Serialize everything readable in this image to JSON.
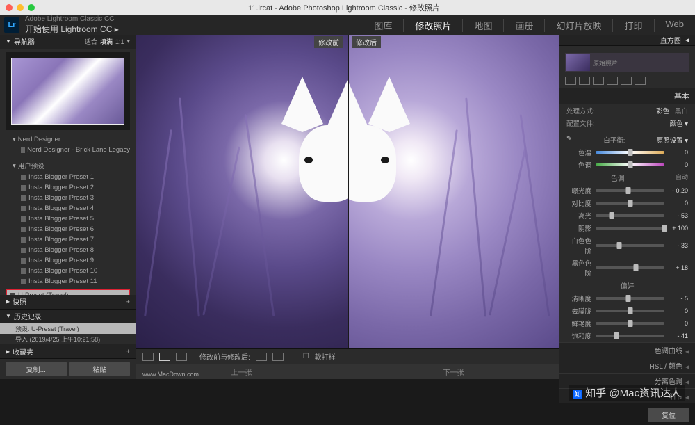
{
  "titlebar": {
    "text": "11.lrcat - Adobe Photoshop Lightroom Classic - 修改照片"
  },
  "traffic": {
    "close": "#ff5f56",
    "min": "#ffbd2e",
    "max": "#27c93f"
  },
  "header": {
    "app_line1": "Adobe Lightroom Classic CC",
    "app_line2": "开始使用 Lightroom CC ▸"
  },
  "modules": [
    {
      "label": "图库",
      "active": false
    },
    {
      "label": "修改照片",
      "active": true
    },
    {
      "label": "地图",
      "active": false
    },
    {
      "label": "画册",
      "active": false
    },
    {
      "label": "幻灯片放映",
      "active": false
    },
    {
      "label": "打印",
      "active": false
    },
    {
      "label": "Web",
      "active": false
    }
  ],
  "left": {
    "navigator": {
      "title": "导航器",
      "fit": "适合",
      "fill": "填满",
      "ratio": "1:1"
    },
    "nerd_header": "Nerd Designer",
    "nerd_item": "Nerd Designer - Brick Lane Legacy",
    "user_presets_header": "用户预设",
    "presets": [
      "Insta Blogger Preset 1",
      "Insta Blogger Preset 2",
      "Insta Blogger Preset 3",
      "Insta Blogger Preset 4",
      "Insta Blogger Preset 5",
      "Insta Blogger Preset 6",
      "Insta Blogger Preset 7",
      "Insta Blogger Preset 8",
      "Insta Blogger Preset 9",
      "Insta Blogger Preset 10",
      "Insta Blogger Preset 11"
    ],
    "selected_preset": "U-Preset (Travel)",
    "snapshot": "快照",
    "history": "历史记录",
    "history_items": [
      "预设: U-Preset (Travel)",
      "导入 (2019/4/25 上午10:21:58)"
    ],
    "collections": "收藏夹",
    "copy_btn": "复制...",
    "paste_btn": "粘贴"
  },
  "center": {
    "before": "修改前",
    "after": "修改后",
    "compare_label": "修改前与修改后:",
    "soft_proof": "软打样",
    "prev": "上一张",
    "next": "下一张"
  },
  "right": {
    "histogram": "直方图",
    "original_photo": "原始照片",
    "basic": "基本",
    "treatment": "处理方式:",
    "color": "彩色",
    "bw": "黑白",
    "profile_lbl": "配置文件:",
    "profile_val": "颜色 ▾",
    "wb_lbl": "白平衡:",
    "wb_val": "原照设置 ▾",
    "temp_lbl": "色温",
    "temp_val": "0",
    "tint_lbl": "色调",
    "tint_val": "0",
    "tone_hdr": "色调",
    "auto": "自动",
    "exposure_lbl": "曝光度",
    "exposure_val": "- 0.20",
    "contrast_lbl": "对比度",
    "contrast_val": "0",
    "highlights_lbl": "高光",
    "highlights_val": "- 53",
    "shadows_lbl": "阴影",
    "shadows_val": "+ 100",
    "whites_lbl": "白色色阶",
    "whites_val": "- 33",
    "blacks_lbl": "黑色色阶",
    "blacks_val": "+ 18",
    "presence_hdr": "偏好",
    "texture_lbl": "清晰度",
    "texture_val": "- 5",
    "dehaze_lbl": "去朦胧",
    "dehaze_val": "0",
    "vibrance_lbl": "鲜艳度",
    "vibrance_val": "0",
    "saturation_lbl": "饱和度",
    "saturation_val": "- 41",
    "panels": [
      "色调曲线",
      "HSL / 颜色",
      "分离色调",
      "细节"
    ],
    "reset": "复位"
  },
  "watermark": "知乎 @Mac资讯达人",
  "url_mark": "www.MacDown.com"
}
